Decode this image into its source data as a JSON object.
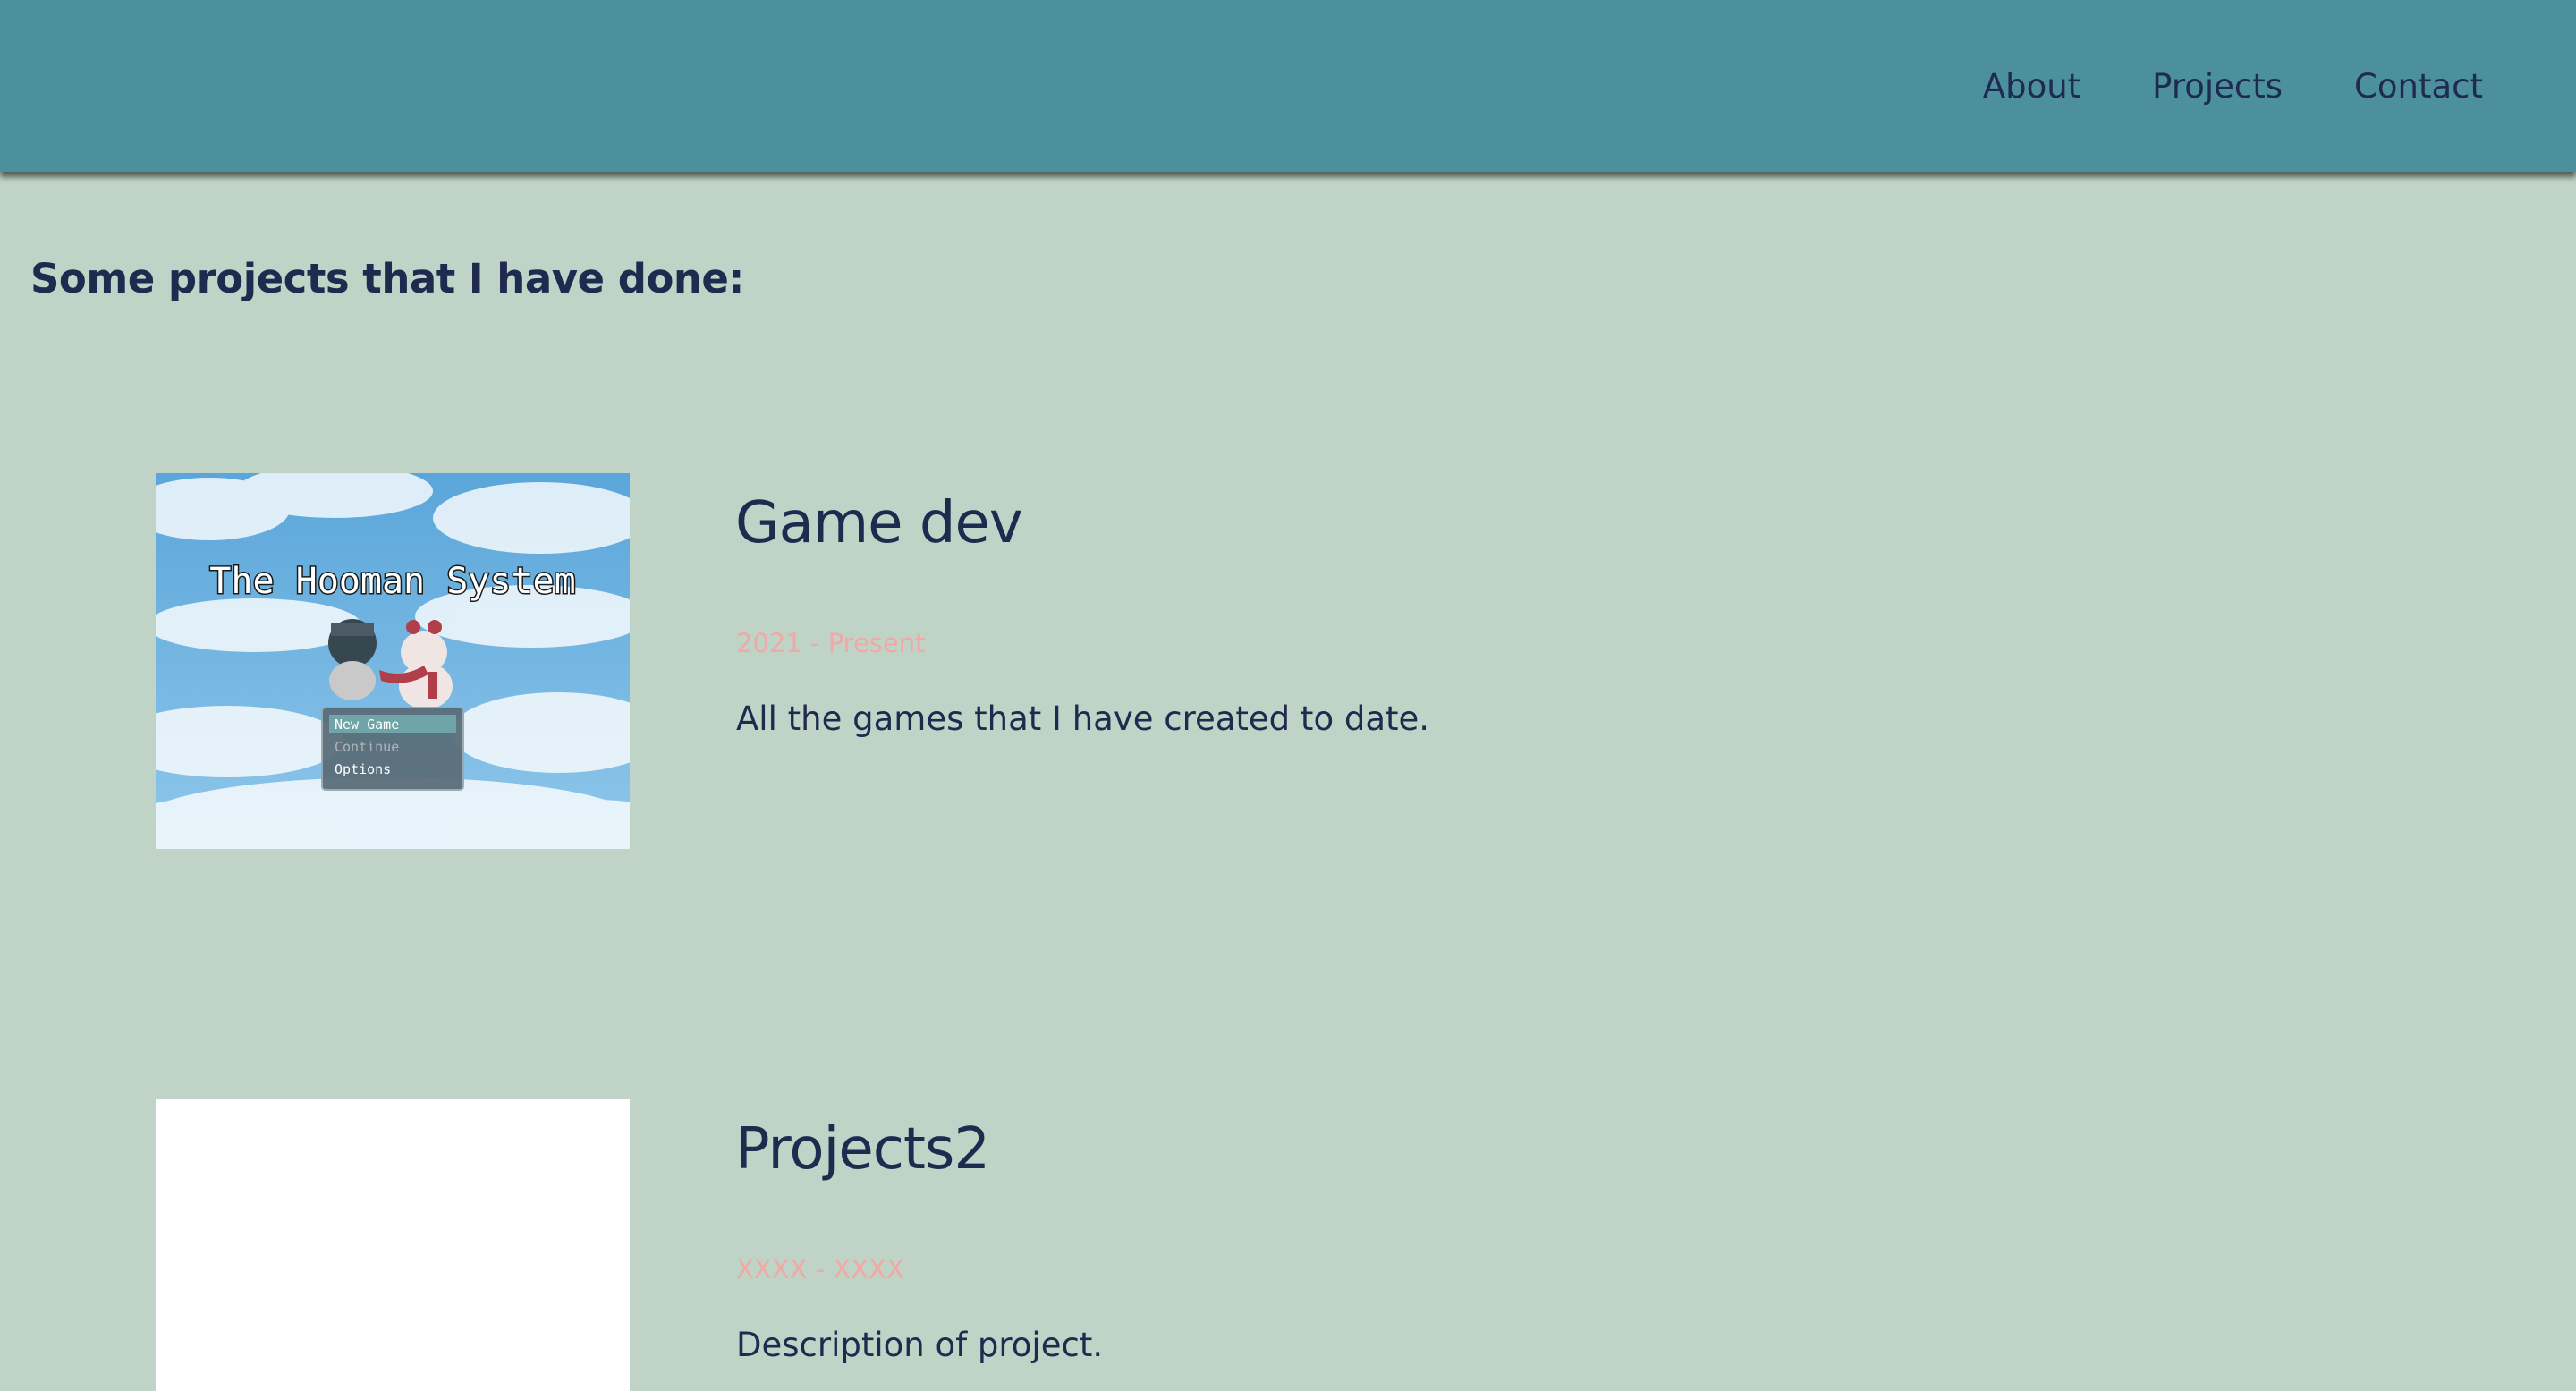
{
  "nav": {
    "items": [
      {
        "label": "About"
      },
      {
        "label": "Projects"
      },
      {
        "label": "Contact"
      }
    ]
  },
  "main": {
    "heading": "Some projects that I have done:",
    "projects": [
      {
        "title": "Game dev",
        "dates": "2021 - Present",
        "description": "All the games that I have created to date.",
        "thumbnail": {
          "game_title": "The Hooman System",
          "menu": [
            "New Game",
            "Continue",
            "Options"
          ]
        }
      },
      {
        "title": "Projects2",
        "dates": "XXXX - XXXX",
        "description": "Description of project."
      }
    ]
  },
  "colors": {
    "header": "#4b909c",
    "background": "#bfd4c6",
    "text": "#1f2a4f",
    "date_accent": "#f1a9a5"
  }
}
